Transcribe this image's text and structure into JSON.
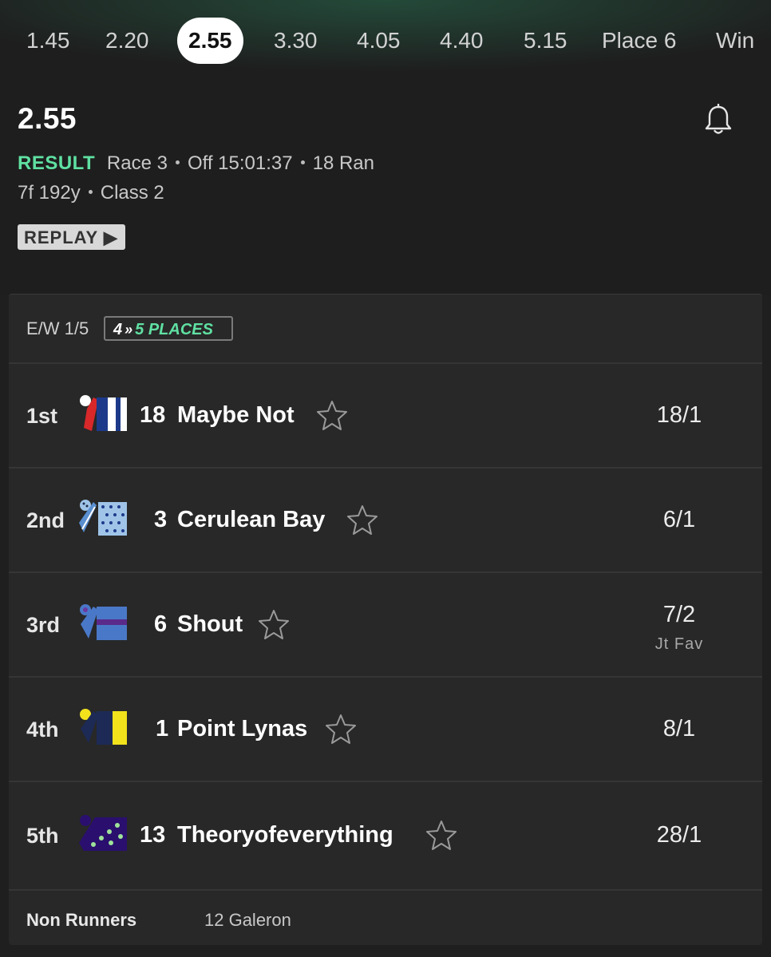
{
  "tabs": [
    {
      "label": "1.45"
    },
    {
      "label": "2.20"
    },
    {
      "label": "2.55",
      "active": true
    },
    {
      "label": "3.30"
    },
    {
      "label": "4.05"
    },
    {
      "label": "4.40"
    },
    {
      "label": "5.15"
    },
    {
      "label": "Place 6"
    },
    {
      "label": "Win"
    }
  ],
  "header": {
    "title": "2.55",
    "status": "RESULT",
    "race": "Race 3",
    "off": "Off 15:01:37",
    "ran": "18 Ran",
    "distance": "7f 192y",
    "class": "Class 2",
    "replay_label": "REPLAY ▶"
  },
  "ew": {
    "terms": "E/W 1/5",
    "places_from": "4",
    "places_arrow": "»",
    "places_to": "5 PLACES"
  },
  "runners": [
    {
      "position": "1st",
      "number": "18",
      "name": "Maybe Not",
      "odds": "18/1",
      "odds_note": ""
    },
    {
      "position": "2nd",
      "number": "3",
      "name": "Cerulean Bay",
      "odds": "6/1",
      "odds_note": ""
    },
    {
      "position": "3rd",
      "number": "6",
      "name": "Shout",
      "odds": "7/2",
      "odds_note": "Jt Fav"
    },
    {
      "position": "4th",
      "number": "1",
      "name": "Point Lynas",
      "odds": "8/1",
      "odds_note": ""
    },
    {
      "position": "5th",
      "number": "13",
      "name": "Theoryofeverything",
      "odds": "28/1",
      "odds_note": ""
    }
  ],
  "non_runners": {
    "label": "Non Runners",
    "value": "12 Galeron"
  },
  "colors": {
    "accent_green": "#5fe0a2",
    "background": "#1f1f1f",
    "card": "#282828"
  },
  "icons": {
    "bell": "bell-icon",
    "star": "star-outline-icon",
    "replay": "play-triangle-icon"
  }
}
